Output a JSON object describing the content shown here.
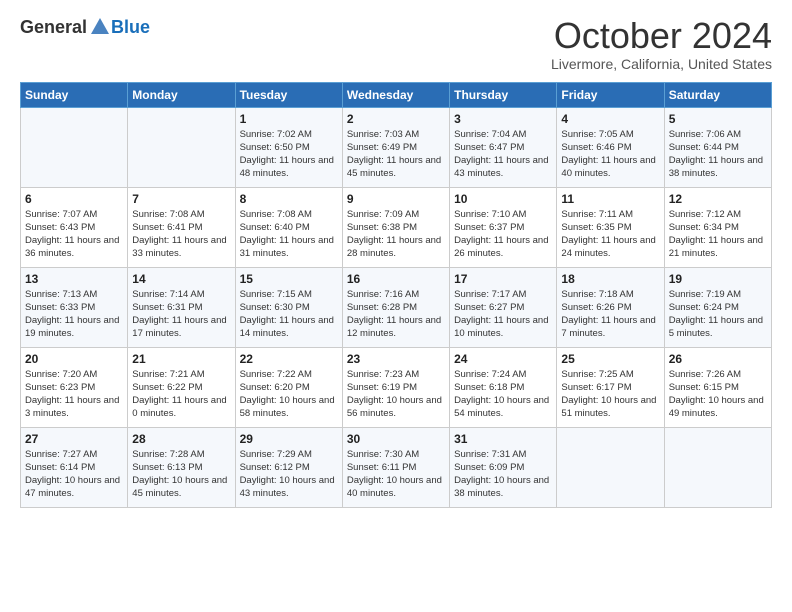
{
  "logo": {
    "general": "General",
    "blue": "Blue"
  },
  "header": {
    "month": "October 2024",
    "location": "Livermore, California, United States"
  },
  "weekdays": [
    "Sunday",
    "Monday",
    "Tuesday",
    "Wednesday",
    "Thursday",
    "Friday",
    "Saturday"
  ],
  "weeks": [
    [
      {
        "day": "",
        "sunrise": "",
        "sunset": "",
        "daylight": ""
      },
      {
        "day": "",
        "sunrise": "",
        "sunset": "",
        "daylight": ""
      },
      {
        "day": "1",
        "sunrise": "Sunrise: 7:02 AM",
        "sunset": "Sunset: 6:50 PM",
        "daylight": "Daylight: 11 hours and 48 minutes."
      },
      {
        "day": "2",
        "sunrise": "Sunrise: 7:03 AM",
        "sunset": "Sunset: 6:49 PM",
        "daylight": "Daylight: 11 hours and 45 minutes."
      },
      {
        "day": "3",
        "sunrise": "Sunrise: 7:04 AM",
        "sunset": "Sunset: 6:47 PM",
        "daylight": "Daylight: 11 hours and 43 minutes."
      },
      {
        "day": "4",
        "sunrise": "Sunrise: 7:05 AM",
        "sunset": "Sunset: 6:46 PM",
        "daylight": "Daylight: 11 hours and 40 minutes."
      },
      {
        "day": "5",
        "sunrise": "Sunrise: 7:06 AM",
        "sunset": "Sunset: 6:44 PM",
        "daylight": "Daylight: 11 hours and 38 minutes."
      }
    ],
    [
      {
        "day": "6",
        "sunrise": "Sunrise: 7:07 AM",
        "sunset": "Sunset: 6:43 PM",
        "daylight": "Daylight: 11 hours and 36 minutes."
      },
      {
        "day": "7",
        "sunrise": "Sunrise: 7:08 AM",
        "sunset": "Sunset: 6:41 PM",
        "daylight": "Daylight: 11 hours and 33 minutes."
      },
      {
        "day": "8",
        "sunrise": "Sunrise: 7:08 AM",
        "sunset": "Sunset: 6:40 PM",
        "daylight": "Daylight: 11 hours and 31 minutes."
      },
      {
        "day": "9",
        "sunrise": "Sunrise: 7:09 AM",
        "sunset": "Sunset: 6:38 PM",
        "daylight": "Daylight: 11 hours and 28 minutes."
      },
      {
        "day": "10",
        "sunrise": "Sunrise: 7:10 AM",
        "sunset": "Sunset: 6:37 PM",
        "daylight": "Daylight: 11 hours and 26 minutes."
      },
      {
        "day": "11",
        "sunrise": "Sunrise: 7:11 AM",
        "sunset": "Sunset: 6:35 PM",
        "daylight": "Daylight: 11 hours and 24 minutes."
      },
      {
        "day": "12",
        "sunrise": "Sunrise: 7:12 AM",
        "sunset": "Sunset: 6:34 PM",
        "daylight": "Daylight: 11 hours and 21 minutes."
      }
    ],
    [
      {
        "day": "13",
        "sunrise": "Sunrise: 7:13 AM",
        "sunset": "Sunset: 6:33 PM",
        "daylight": "Daylight: 11 hours and 19 minutes."
      },
      {
        "day": "14",
        "sunrise": "Sunrise: 7:14 AM",
        "sunset": "Sunset: 6:31 PM",
        "daylight": "Daylight: 11 hours and 17 minutes."
      },
      {
        "day": "15",
        "sunrise": "Sunrise: 7:15 AM",
        "sunset": "Sunset: 6:30 PM",
        "daylight": "Daylight: 11 hours and 14 minutes."
      },
      {
        "day": "16",
        "sunrise": "Sunrise: 7:16 AM",
        "sunset": "Sunset: 6:28 PM",
        "daylight": "Daylight: 11 hours and 12 minutes."
      },
      {
        "day": "17",
        "sunrise": "Sunrise: 7:17 AM",
        "sunset": "Sunset: 6:27 PM",
        "daylight": "Daylight: 11 hours and 10 minutes."
      },
      {
        "day": "18",
        "sunrise": "Sunrise: 7:18 AM",
        "sunset": "Sunset: 6:26 PM",
        "daylight": "Daylight: 11 hours and 7 minutes."
      },
      {
        "day": "19",
        "sunrise": "Sunrise: 7:19 AM",
        "sunset": "Sunset: 6:24 PM",
        "daylight": "Daylight: 11 hours and 5 minutes."
      }
    ],
    [
      {
        "day": "20",
        "sunrise": "Sunrise: 7:20 AM",
        "sunset": "Sunset: 6:23 PM",
        "daylight": "Daylight: 11 hours and 3 minutes."
      },
      {
        "day": "21",
        "sunrise": "Sunrise: 7:21 AM",
        "sunset": "Sunset: 6:22 PM",
        "daylight": "Daylight: 11 hours and 0 minutes."
      },
      {
        "day": "22",
        "sunrise": "Sunrise: 7:22 AM",
        "sunset": "Sunset: 6:20 PM",
        "daylight": "Daylight: 10 hours and 58 minutes."
      },
      {
        "day": "23",
        "sunrise": "Sunrise: 7:23 AM",
        "sunset": "Sunset: 6:19 PM",
        "daylight": "Daylight: 10 hours and 56 minutes."
      },
      {
        "day": "24",
        "sunrise": "Sunrise: 7:24 AM",
        "sunset": "Sunset: 6:18 PM",
        "daylight": "Daylight: 10 hours and 54 minutes."
      },
      {
        "day": "25",
        "sunrise": "Sunrise: 7:25 AM",
        "sunset": "Sunset: 6:17 PM",
        "daylight": "Daylight: 10 hours and 51 minutes."
      },
      {
        "day": "26",
        "sunrise": "Sunrise: 7:26 AM",
        "sunset": "Sunset: 6:15 PM",
        "daylight": "Daylight: 10 hours and 49 minutes."
      }
    ],
    [
      {
        "day": "27",
        "sunrise": "Sunrise: 7:27 AM",
        "sunset": "Sunset: 6:14 PM",
        "daylight": "Daylight: 10 hours and 47 minutes."
      },
      {
        "day": "28",
        "sunrise": "Sunrise: 7:28 AM",
        "sunset": "Sunset: 6:13 PM",
        "daylight": "Daylight: 10 hours and 45 minutes."
      },
      {
        "day": "29",
        "sunrise": "Sunrise: 7:29 AM",
        "sunset": "Sunset: 6:12 PM",
        "daylight": "Daylight: 10 hours and 43 minutes."
      },
      {
        "day": "30",
        "sunrise": "Sunrise: 7:30 AM",
        "sunset": "Sunset: 6:11 PM",
        "daylight": "Daylight: 10 hours and 40 minutes."
      },
      {
        "day": "31",
        "sunrise": "Sunrise: 7:31 AM",
        "sunset": "Sunset: 6:09 PM",
        "daylight": "Daylight: 10 hours and 38 minutes."
      },
      {
        "day": "",
        "sunrise": "",
        "sunset": "",
        "daylight": ""
      },
      {
        "day": "",
        "sunrise": "",
        "sunset": "",
        "daylight": ""
      }
    ]
  ]
}
